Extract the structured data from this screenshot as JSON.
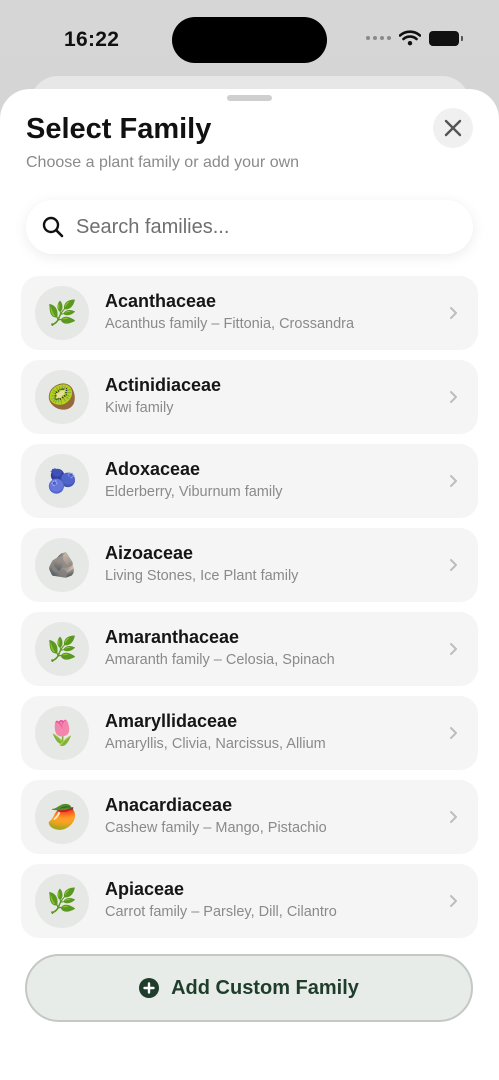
{
  "status_bar": {
    "time": "16:22"
  },
  "sheet": {
    "title": "Select Family",
    "subtitle": "Choose a plant family or add your own"
  },
  "search": {
    "placeholder": "Search families..."
  },
  "families": [
    {
      "emoji": "🌿",
      "name": "Acanthaceae",
      "description": "Acanthus family – Fittonia, Crossandra"
    },
    {
      "emoji": "🥝",
      "name": "Actinidiaceae",
      "description": "Kiwi family"
    },
    {
      "emoji": "🫐",
      "name": "Adoxaceae",
      "description": "Elderberry, Viburnum family"
    },
    {
      "emoji": "🪨",
      "name": "Aizoaceae",
      "description": "Living Stones, Ice Plant family"
    },
    {
      "emoji": "🌿",
      "name": "Amaranthaceae",
      "description": "Amaranth family – Celosia, Spinach"
    },
    {
      "emoji": "🌷",
      "name": "Amaryllidaceae",
      "description": "Amaryllis, Clivia, Narcissus, Allium"
    },
    {
      "emoji": "🥭",
      "name": "Anacardiaceae",
      "description": "Cashew family – Mango, Pistachio"
    },
    {
      "emoji": "🌿",
      "name": "Apiaceae",
      "description": "Carrot family – Parsley, Dill, Cilantro"
    }
  ],
  "add_button": {
    "label": "Add Custom Family"
  },
  "colors": {
    "accent": "#1f3d2b",
    "card": "#f5f5f5",
    "muted_text": "#8a8a8a"
  },
  "icons": {
    "close": "close-icon",
    "search": "search-icon",
    "chevron": "chevron-right-icon",
    "add": "plus-circle-icon",
    "wifi": "wifi-icon",
    "battery": "battery-icon"
  }
}
